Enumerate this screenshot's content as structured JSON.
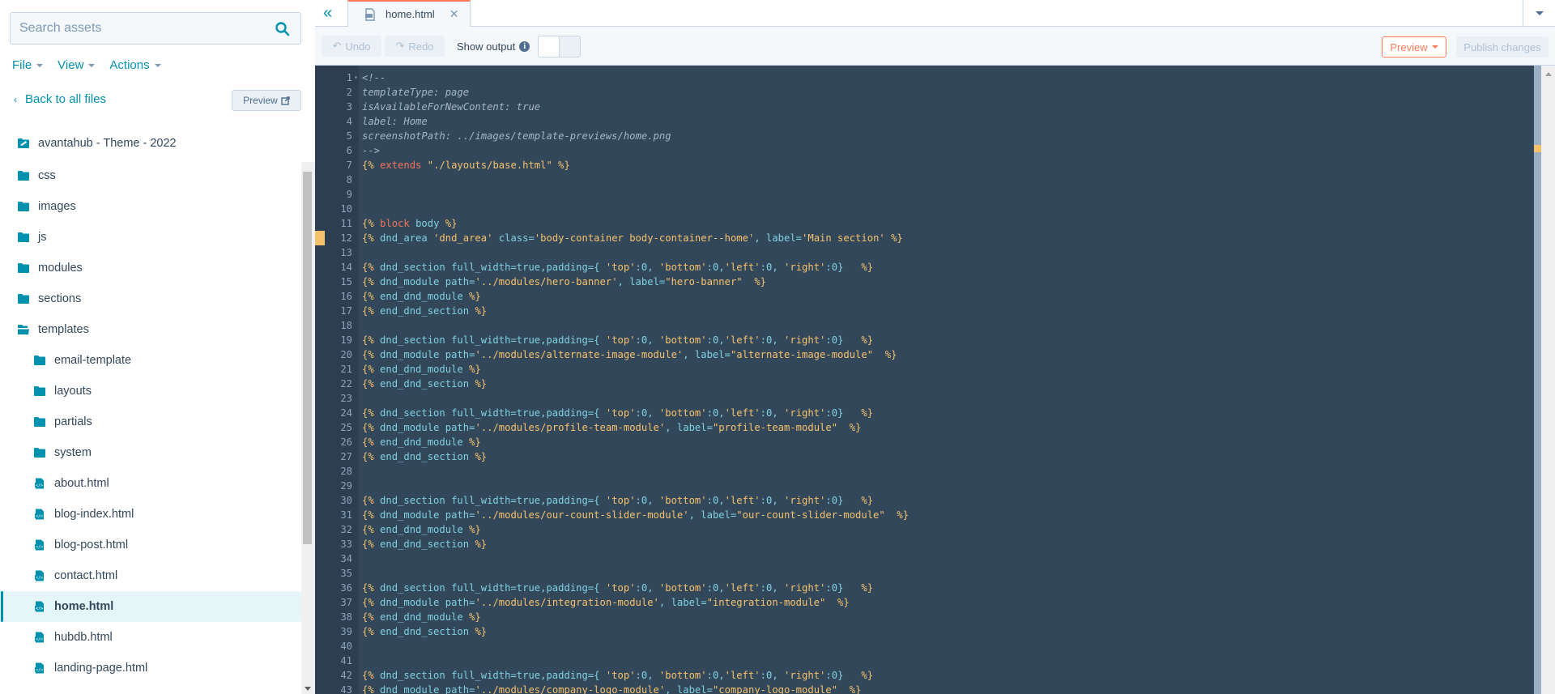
{
  "sidebar": {
    "search_placeholder": "Search assets",
    "menu": [
      {
        "label": "File"
      },
      {
        "label": "View"
      },
      {
        "label": "Actions"
      }
    ],
    "back_label": "Back to all files",
    "preview_label": "Preview",
    "tree": [
      {
        "label": "avantahub - Theme - 2022",
        "type": "theme",
        "level": 0
      },
      {
        "label": "css",
        "type": "folder",
        "level": 0
      },
      {
        "label": "images",
        "type": "folder",
        "level": 0
      },
      {
        "label": "js",
        "type": "folder",
        "level": 0
      },
      {
        "label": "modules",
        "type": "folder",
        "level": 0
      },
      {
        "label": "sections",
        "type": "folder",
        "level": 0
      },
      {
        "label": "templates",
        "type": "folder-open",
        "level": 0
      },
      {
        "label": "email-template",
        "type": "folder",
        "level": 1
      },
      {
        "label": "layouts",
        "type": "folder",
        "level": 1
      },
      {
        "label": "partials",
        "type": "folder",
        "level": 1
      },
      {
        "label": "system",
        "type": "folder",
        "level": 1
      },
      {
        "label": "about.html",
        "type": "file",
        "level": 1
      },
      {
        "label": "blog-index.html",
        "type": "file",
        "level": 1
      },
      {
        "label": "blog-post.html",
        "type": "file",
        "level": 1
      },
      {
        "label": "contact.html",
        "type": "file",
        "level": 1
      },
      {
        "label": "home.html",
        "type": "file",
        "level": 1,
        "selected": true
      },
      {
        "label": "hubdb.html",
        "type": "file",
        "level": 1
      },
      {
        "label": "landing-page.html",
        "type": "file",
        "level": 1
      }
    ]
  },
  "editor": {
    "tab_label": "home.html",
    "toolbar": {
      "undo_label": "Undo",
      "redo_label": "Redo",
      "show_output_label": "Show output",
      "show_output_on": false,
      "preview_label": "Preview",
      "publish_label": "Publish changes"
    },
    "colors": {
      "accent": "#0091ae",
      "orange": "#ff7a59",
      "editor_bg": "#33475b",
      "change_marker": "#f5c26b"
    },
    "modified_lines": [
      12
    ],
    "code_lines": [
      [
        {
          "t": "<!--",
          "c": "com"
        }
      ],
      [
        {
          "t": "templateType: page",
          "c": "com"
        }
      ],
      [
        {
          "t": "isAvailableForNewContent: true",
          "c": "com"
        }
      ],
      [
        {
          "t": "label: Home",
          "c": "com"
        }
      ],
      [
        {
          "t": "screenshotPath: ../images/template-previews/home.png",
          "c": "com"
        }
      ],
      [
        {
          "t": "-->",
          "c": "com"
        }
      ],
      [
        {
          "t": "{%",
          "c": "tag"
        },
        {
          "t": " extends ",
          "c": "kw"
        },
        {
          "t": "\"./layouts/base.html\"",
          "c": "str"
        },
        {
          "t": " %}",
          "c": "tag"
        }
      ],
      [],
      [],
      [],
      [
        {
          "t": "{%",
          "c": "tag"
        },
        {
          "t": " block ",
          "c": "kw"
        },
        {
          "t": "body",
          "c": "id"
        },
        {
          "t": " %}",
          "c": "tag"
        }
      ],
      [
        {
          "t": "{%",
          "c": "tag"
        },
        {
          "t": " dnd_area ",
          "c": "id"
        },
        {
          "t": "'dnd_area'",
          "c": "str"
        },
        {
          "t": " class=",
          "c": "id"
        },
        {
          "t": "'body-container body-container--home'",
          "c": "str"
        },
        {
          "t": ", label=",
          "c": "id"
        },
        {
          "t": "'Main section'",
          "c": "str"
        },
        {
          "t": " %}",
          "c": "tag"
        }
      ],
      [],
      [
        {
          "t": "{%",
          "c": "tag"
        },
        {
          "t": " dnd_section full_width=true,padding={ ",
          "c": "id"
        },
        {
          "t": "'top'",
          "c": "str"
        },
        {
          "t": ":0, ",
          "c": "num"
        },
        {
          "t": "'bottom'",
          "c": "str"
        },
        {
          "t": ":0,",
          "c": "num"
        },
        {
          "t": "'left'",
          "c": "str"
        },
        {
          "t": ":0, ",
          "c": "num"
        },
        {
          "t": "'right'",
          "c": "str"
        },
        {
          "t": ":0}   ",
          "c": "num"
        },
        {
          "t": "%}",
          "c": "tag"
        }
      ],
      [
        {
          "t": "{%",
          "c": "tag"
        },
        {
          "t": " dnd_module path=",
          "c": "id"
        },
        {
          "t": "'../modules/hero-banner'",
          "c": "str"
        },
        {
          "t": ", label=",
          "c": "id"
        },
        {
          "t": "\"hero-banner\"",
          "c": "str"
        },
        {
          "t": "  %}",
          "c": "tag"
        }
      ],
      [
        {
          "t": "{%",
          "c": "tag"
        },
        {
          "t": " end_dnd_module ",
          "c": "id"
        },
        {
          "t": "%}",
          "c": "tag"
        }
      ],
      [
        {
          "t": "{%",
          "c": "tag"
        },
        {
          "t": " end_dnd_section ",
          "c": "id"
        },
        {
          "t": "%}",
          "c": "tag"
        }
      ],
      [],
      [
        {
          "t": "{%",
          "c": "tag"
        },
        {
          "t": " dnd_section full_width=true,padding={ ",
          "c": "id"
        },
        {
          "t": "'top'",
          "c": "str"
        },
        {
          "t": ":0, ",
          "c": "num"
        },
        {
          "t": "'bottom'",
          "c": "str"
        },
        {
          "t": ":0,",
          "c": "num"
        },
        {
          "t": "'left'",
          "c": "str"
        },
        {
          "t": ":0, ",
          "c": "num"
        },
        {
          "t": "'right'",
          "c": "str"
        },
        {
          "t": ":0}   ",
          "c": "num"
        },
        {
          "t": "%}",
          "c": "tag"
        }
      ],
      [
        {
          "t": "{%",
          "c": "tag"
        },
        {
          "t": " dnd_module path=",
          "c": "id"
        },
        {
          "t": "'../modules/alternate-image-module'",
          "c": "str"
        },
        {
          "t": ", label=",
          "c": "id"
        },
        {
          "t": "\"alternate-image-module\"",
          "c": "str"
        },
        {
          "t": "  %}",
          "c": "tag"
        }
      ],
      [
        {
          "t": "{%",
          "c": "tag"
        },
        {
          "t": " end_dnd_module ",
          "c": "id"
        },
        {
          "t": "%}",
          "c": "tag"
        }
      ],
      [
        {
          "t": "{%",
          "c": "tag"
        },
        {
          "t": " end_dnd_section ",
          "c": "id"
        },
        {
          "t": "%}",
          "c": "tag"
        }
      ],
      [],
      [
        {
          "t": "{%",
          "c": "tag"
        },
        {
          "t": " dnd_section full_width=true,padding={ ",
          "c": "id"
        },
        {
          "t": "'top'",
          "c": "str"
        },
        {
          "t": ":0, ",
          "c": "num"
        },
        {
          "t": "'bottom'",
          "c": "str"
        },
        {
          "t": ":0,",
          "c": "num"
        },
        {
          "t": "'left'",
          "c": "str"
        },
        {
          "t": ":0, ",
          "c": "num"
        },
        {
          "t": "'right'",
          "c": "str"
        },
        {
          "t": ":0}   ",
          "c": "num"
        },
        {
          "t": "%}",
          "c": "tag"
        }
      ],
      [
        {
          "t": "{%",
          "c": "tag"
        },
        {
          "t": " dnd_module path=",
          "c": "id"
        },
        {
          "t": "'../modules/profile-team-module'",
          "c": "str"
        },
        {
          "t": ", label=",
          "c": "id"
        },
        {
          "t": "\"profile-team-module\"",
          "c": "str"
        },
        {
          "t": "  %}",
          "c": "tag"
        }
      ],
      [
        {
          "t": "{%",
          "c": "tag"
        },
        {
          "t": " end_dnd_module ",
          "c": "id"
        },
        {
          "t": "%}",
          "c": "tag"
        }
      ],
      [
        {
          "t": "{%",
          "c": "tag"
        },
        {
          "t": " end_dnd_section ",
          "c": "id"
        },
        {
          "t": "%}",
          "c": "tag"
        }
      ],
      [],
      [],
      [
        {
          "t": "{%",
          "c": "tag"
        },
        {
          "t": " dnd_section full_width=true,padding={ ",
          "c": "id"
        },
        {
          "t": "'top'",
          "c": "str"
        },
        {
          "t": ":0, ",
          "c": "num"
        },
        {
          "t": "'bottom'",
          "c": "str"
        },
        {
          "t": ":0,",
          "c": "num"
        },
        {
          "t": "'left'",
          "c": "str"
        },
        {
          "t": ":0, ",
          "c": "num"
        },
        {
          "t": "'right'",
          "c": "str"
        },
        {
          "t": ":0}   ",
          "c": "num"
        },
        {
          "t": "%}",
          "c": "tag"
        }
      ],
      [
        {
          "t": "{%",
          "c": "tag"
        },
        {
          "t": " dnd_module path=",
          "c": "id"
        },
        {
          "t": "'../modules/our-count-slider-module'",
          "c": "str"
        },
        {
          "t": ", label=",
          "c": "id"
        },
        {
          "t": "\"our-count-slider-module\"",
          "c": "str"
        },
        {
          "t": "  %}",
          "c": "tag"
        }
      ],
      [
        {
          "t": "{%",
          "c": "tag"
        },
        {
          "t": " end_dnd_module ",
          "c": "id"
        },
        {
          "t": "%}",
          "c": "tag"
        }
      ],
      [
        {
          "t": "{%",
          "c": "tag"
        },
        {
          "t": " end_dnd_section ",
          "c": "id"
        },
        {
          "t": "%}",
          "c": "tag"
        }
      ],
      [],
      [],
      [
        {
          "t": "{%",
          "c": "tag"
        },
        {
          "t": " dnd_section full_width=true,padding={ ",
          "c": "id"
        },
        {
          "t": "'top'",
          "c": "str"
        },
        {
          "t": ":0, ",
          "c": "num"
        },
        {
          "t": "'bottom'",
          "c": "str"
        },
        {
          "t": ":0,",
          "c": "num"
        },
        {
          "t": "'left'",
          "c": "str"
        },
        {
          "t": ":0, ",
          "c": "num"
        },
        {
          "t": "'right'",
          "c": "str"
        },
        {
          "t": ":0}   ",
          "c": "num"
        },
        {
          "t": "%}",
          "c": "tag"
        }
      ],
      [
        {
          "t": "{%",
          "c": "tag"
        },
        {
          "t": " dnd_module path=",
          "c": "id"
        },
        {
          "t": "'../modules/integration-module'",
          "c": "str"
        },
        {
          "t": ", label=",
          "c": "id"
        },
        {
          "t": "\"integration-module\"",
          "c": "str"
        },
        {
          "t": "  %}",
          "c": "tag"
        }
      ],
      [
        {
          "t": "{%",
          "c": "tag"
        },
        {
          "t": " end_dnd_module ",
          "c": "id"
        },
        {
          "t": "%}",
          "c": "tag"
        }
      ],
      [
        {
          "t": "{%",
          "c": "tag"
        },
        {
          "t": " end_dnd_section ",
          "c": "id"
        },
        {
          "t": "%}",
          "c": "tag"
        }
      ],
      [],
      [],
      [
        {
          "t": "{%",
          "c": "tag"
        },
        {
          "t": " dnd_section full_width=true,padding={ ",
          "c": "id"
        },
        {
          "t": "'top'",
          "c": "str"
        },
        {
          "t": ":0, ",
          "c": "num"
        },
        {
          "t": "'bottom'",
          "c": "str"
        },
        {
          "t": ":0,",
          "c": "num"
        },
        {
          "t": "'left'",
          "c": "str"
        },
        {
          "t": ":0, ",
          "c": "num"
        },
        {
          "t": "'right'",
          "c": "str"
        },
        {
          "t": ":0}   ",
          "c": "num"
        },
        {
          "t": "%}",
          "c": "tag"
        }
      ],
      [
        {
          "t": "{%",
          "c": "tag"
        },
        {
          "t": " dnd_module path=",
          "c": "id"
        },
        {
          "t": "'../modules/company-logo-module'",
          "c": "str"
        },
        {
          "t": ", label=",
          "c": "id"
        },
        {
          "t": "\"company-logo-module\"",
          "c": "str"
        },
        {
          "t": "  %}",
          "c": "tag"
        }
      ]
    ]
  }
}
